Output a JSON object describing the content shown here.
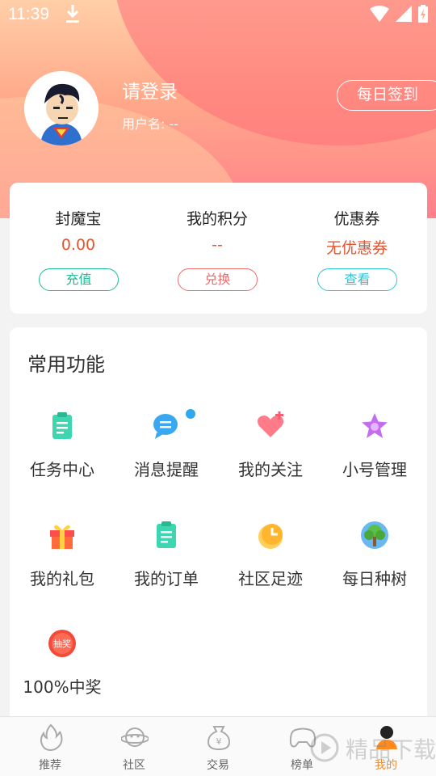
{
  "status_bar": {
    "time": "11:39"
  },
  "profile": {
    "login_text": "请登录",
    "username_label": "用户名:",
    "username_value": "--",
    "checkin_button": "每日签到"
  },
  "wallet": {
    "items": [
      {
        "label": "封魔宝",
        "value": "0.00",
        "button": "充值",
        "value_color": "#e2552f",
        "button_color": "#1dbc93"
      },
      {
        "label": "我的积分",
        "value": "--",
        "button": "兑换",
        "value_color": "#e2552f",
        "button_color": "#f06b6b"
      },
      {
        "label": "优惠券",
        "value": "无优惠券",
        "button": "查看",
        "value_color": "#e2552f",
        "button_color": "#2cc6d6"
      }
    ]
  },
  "features": {
    "title": "常用功能",
    "items": [
      {
        "label": "任务中心",
        "icon": "task-icon"
      },
      {
        "label": "消息提醒",
        "icon": "message-icon"
      },
      {
        "label": "我的关注",
        "icon": "heart-icon"
      },
      {
        "label": "小号管理",
        "icon": "star-icon"
      },
      {
        "label": "我的礼包",
        "icon": "gift-icon"
      },
      {
        "label": "我的订单",
        "icon": "order-icon"
      },
      {
        "label": "社区足迹",
        "icon": "clock-icon"
      },
      {
        "label": "每日种树",
        "icon": "tree-icon"
      },
      {
        "label": "100%中奖",
        "icon": "lottery-icon"
      }
    ],
    "lottery_badge": "抽奖"
  },
  "bottom_nav": {
    "items": [
      {
        "label": "推荐",
        "icon": "flame-icon"
      },
      {
        "label": "社区",
        "icon": "planet-icon"
      },
      {
        "label": "交易",
        "icon": "money-bag-icon"
      },
      {
        "label": "榜单",
        "icon": "gamepad-icon"
      },
      {
        "label": "我的",
        "icon": "user-icon"
      }
    ],
    "active_index": 4
  },
  "watermark": {
    "text": "精品下载"
  },
  "colors": {
    "accent": "#ff8a1f",
    "header_top": "#ffcfa8",
    "header_bottom": "#ff7f8a"
  }
}
